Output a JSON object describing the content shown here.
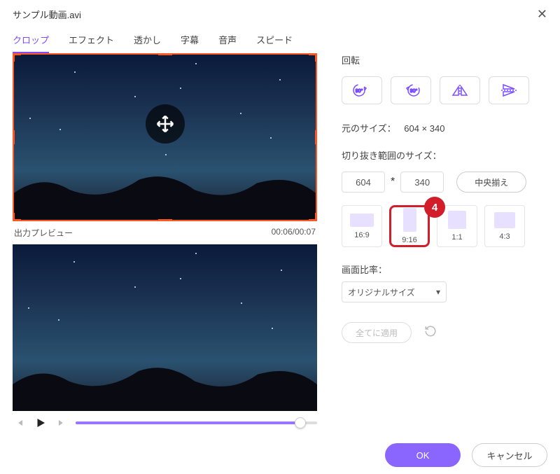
{
  "header": {
    "title": "サンプル動画.avi"
  },
  "tabs": [
    "クロップ",
    "エフェクト",
    "透かし",
    "字幕",
    "音声",
    "スピード"
  ],
  "active_tab": 0,
  "preview": {
    "label": "出力プレビュー",
    "time": "00:06/00:07"
  },
  "rotate": {
    "title": "回転"
  },
  "original": {
    "label": "元のサイズ：",
    "value": "604 × 340"
  },
  "crop": {
    "title": "切り抜き範囲のサイズ：",
    "width": "604",
    "mult": "*",
    "height": "340",
    "center": "中央揃え"
  },
  "aspects": [
    {
      "label": "16:9",
      "cls": "r169"
    },
    {
      "label": "9:16",
      "cls": "r916"
    },
    {
      "label": "1:1",
      "cls": "r11"
    },
    {
      "label": "4:3",
      "cls": "r43"
    }
  ],
  "selected_aspect": 1,
  "callout": "4",
  "ratio": {
    "label": "画面比率：",
    "value": "オリジナルサイズ"
  },
  "apply": {
    "label": "全てに適用"
  },
  "footer": {
    "ok": "OK",
    "cancel": "キャンセル"
  }
}
